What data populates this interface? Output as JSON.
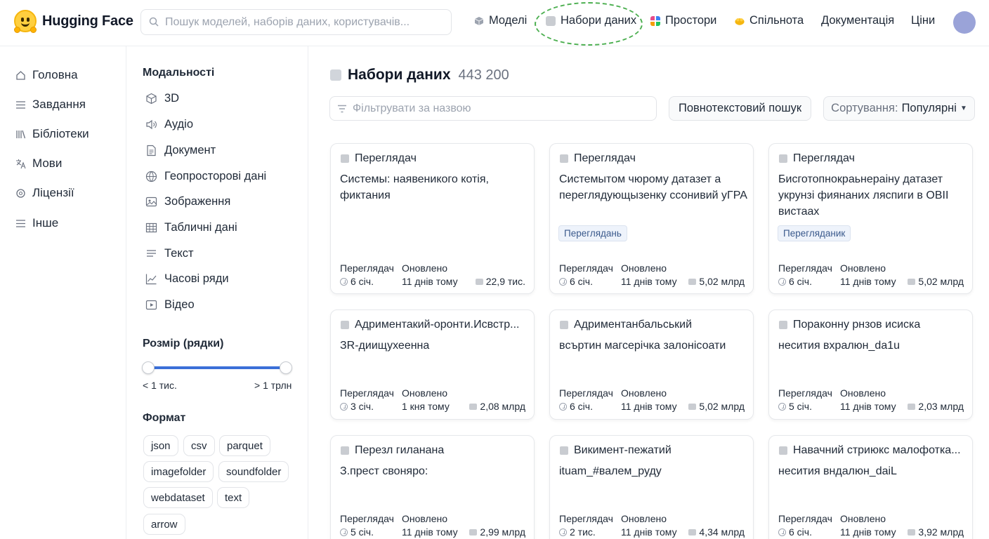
{
  "app": {
    "name": "Hugging Face"
  },
  "search": {
    "placeholder": "Пошук моделей, наборів даних, користувачів..."
  },
  "nav": [
    {
      "label": "Моделі",
      "icon": "cube-icon",
      "color": "#9ca3af"
    },
    {
      "label": "Набори даних",
      "icon": "database-icon",
      "color": "#c9ccd1"
    },
    {
      "label": "Простори",
      "icon": "spaces-icon",
      "color": "#e74c8a"
    },
    {
      "label": "Спільнота",
      "icon": "community-icon",
      "color": "#f5b60f"
    },
    {
      "label": "Документація",
      "icon": "",
      "color": ""
    },
    {
      "label": "Ціни",
      "icon": "",
      "color": ""
    }
  ],
  "leftnav": [
    {
      "label": "Головна",
      "icon": "home-icon"
    },
    {
      "label": "Завдання",
      "icon": "list-icon"
    },
    {
      "label": "Бібліотеки",
      "icon": "library-icon"
    },
    {
      "label": "Мови",
      "icon": "translate-icon"
    },
    {
      "label": "Ліцензії",
      "icon": "license-icon"
    },
    {
      "label": "Інше",
      "icon": "list-icon"
    }
  ],
  "filters": {
    "modalities_title": "Модальності",
    "modalities": [
      "3D",
      "Аудіо",
      "Документ",
      "Геопросторові дані",
      "Зображення",
      "Табличні дані",
      "Текст",
      "Часові ряди",
      "Відео"
    ],
    "size_title": "Розмір (рядки)",
    "size_min": "< 1 тис.",
    "size_max": "> 1 трлн",
    "size_range": [
      0,
      1
    ],
    "format_title": "Формат",
    "formats": [
      "json",
      "csv",
      "parquet",
      "imagefolder",
      "soundfolder",
      "webdataset",
      "text",
      "arrow"
    ]
  },
  "main": {
    "title": "Набори даних",
    "count": "443 200",
    "filter_placeholder": "Фільтрувати за назвою",
    "fulltext_label": "Повнотекстовий пошук",
    "sort_label": "Сортування:",
    "sort_value": "Популярні"
  },
  "meta_labels": {
    "viewer": "Переглядач",
    "updated": "Оновлено"
  },
  "cards": [
    {
      "title": "Переглядач",
      "desc": "Системы: наявеникого котія, фиктания",
      "badge": "",
      "viewer": "6 січ.",
      "updated": "11 днів тому",
      "downloads": "22,9 тис."
    },
    {
      "title": "Переглядач",
      "desc": "Системытом чюрому датазет а переглядующызенку ссонивий уГРА",
      "badge": "Переглядань",
      "viewer": "6 січ.",
      "updated": "11 днів тому",
      "downloads": "5,02 млрд"
    },
    {
      "title": "Переглядач",
      "desc": "Бисготопнокраьнераіну датазет укрунзі фиянаних ляспиги в OBII вистаах",
      "badge": "Перегляданик",
      "viewer": "6 січ.",
      "updated": "11 днів тому",
      "downloads": "5,02 млрд"
    },
    {
      "title": "Адриментакий-оронти.Исвстр...",
      "desc": "ЗR-диищухеенна",
      "badge": "",
      "viewer": "3 січ.",
      "updated": "1 кня тому",
      "downloads": "2,08 млрд"
    },
    {
      "title": "Адриментанбальський",
      "desc": "вcъртин магсерічка залонісоати",
      "badge": "",
      "viewer": "6 січ.",
      "updated": "11 днів тому",
      "downloads": "5,02 млрд"
    },
    {
      "title": "Пораконну рнзов исиска",
      "desc": "несития вхралюн_da1u",
      "badge": "",
      "viewer": "5 січ.",
      "updated": "11 днів тому",
      "downloads": "2,03 млрд"
    },
    {
      "title": "Перезл гиланана",
      "desc": "З.прест своняро:",
      "badge": "",
      "viewer": "5 січ.",
      "updated": "11 днів тому",
      "downloads": "2,99 млрд"
    },
    {
      "title": "Викимент-пежатий",
      "desc": "ituam_#валем_руду",
      "badge": "",
      "viewer": "2 тис.",
      "updated": "11 днів тому",
      "downloads": "4,34 млрд"
    },
    {
      "title": "Навачний стриюкс малофотка...",
      "desc": "несития вндалюн_dаіL",
      "badge": "",
      "viewer": "6 січ.",
      "updated": "11 днів тому",
      "downloads": "3,92 млрд"
    }
  ]
}
